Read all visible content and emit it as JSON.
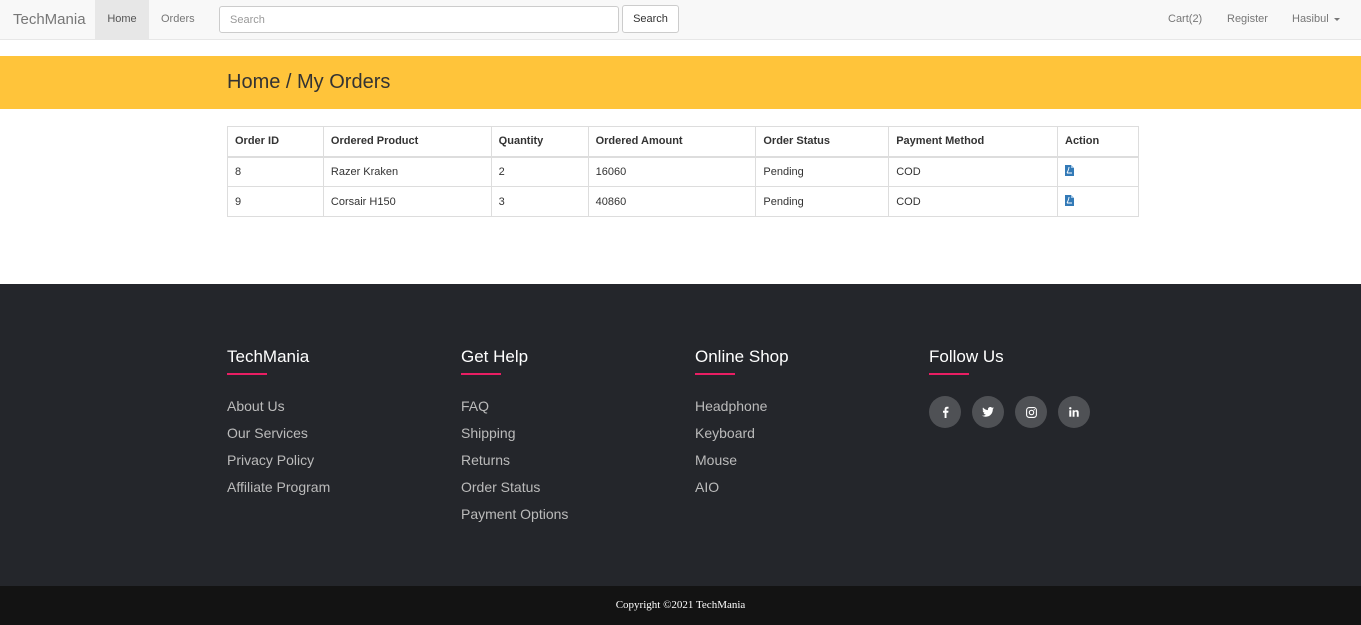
{
  "navbar": {
    "brand": "TechMania",
    "home_label": "Home",
    "orders_label": "Orders",
    "search_placeholder": "Search",
    "search_button": "Search",
    "cart_label": "Cart(2)",
    "register_label": "Register",
    "user_label": "Hasibul"
  },
  "banner": {
    "breadcrumb": "Home / My Orders"
  },
  "table": {
    "headers": [
      "Order ID",
      "Ordered Product",
      "Quantity",
      "Ordered Amount",
      "Order Status",
      "Payment Method",
      "Action"
    ],
    "rows": [
      {
        "id": "8",
        "product": "Razer Kraken",
        "quantity": "2",
        "amount": "16060",
        "status": "Pending",
        "payment": "COD",
        "action_icon": "pdf-file-icon"
      },
      {
        "id": "9",
        "product": "Corsair H150",
        "quantity": "3",
        "amount": "40860",
        "status": "Pending",
        "payment": "COD",
        "action_icon": "pdf-file-icon"
      }
    ]
  },
  "footer": {
    "col1": {
      "title": "TechMania",
      "links": [
        "About Us",
        "Our Services",
        "Privacy Policy",
        "Affiliate Program"
      ]
    },
    "col2": {
      "title": "Get Help",
      "links": [
        "FAQ",
        "Shipping",
        "Returns",
        "Order Status",
        "Payment Options"
      ]
    },
    "col3": {
      "title": "Online Shop",
      "links": [
        "Headphone",
        "Keyboard",
        "Mouse",
        "AIO"
      ]
    },
    "col4": {
      "title": "Follow Us",
      "social_icons": [
        "facebook-icon",
        "twitter-icon",
        "instagram-icon",
        "linkedin-icon"
      ]
    }
  },
  "copyright": "Copyright ©2021 TechMania",
  "colors": {
    "banner": "#ffc43a",
    "footer": "#24262b",
    "accent": "#e91e63",
    "copyright_bar": "#131313",
    "link": "#337ab7"
  }
}
